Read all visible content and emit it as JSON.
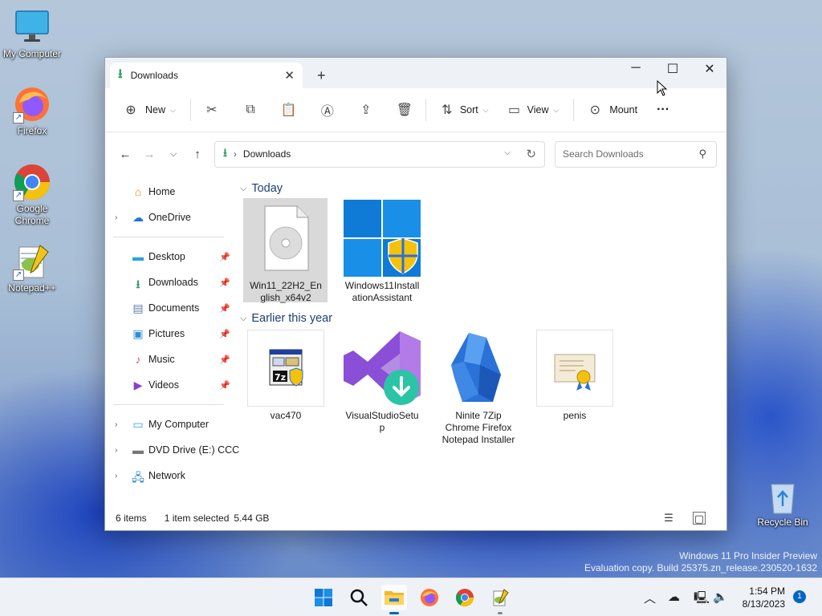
{
  "desktop": {
    "icons": [
      {
        "label": "My Computer"
      },
      {
        "label": "Firefox"
      },
      {
        "label": "Google Chrome"
      },
      {
        "label": "Notepad++"
      },
      {
        "label": "Recycle Bin"
      }
    ],
    "watermark": {
      "line1": "Windows 11 Pro Insider Preview",
      "line2": "Evaluation copy. Build 25375.zn_release.230520-1632"
    }
  },
  "window": {
    "tab": {
      "label": "Downloads",
      "icon": "download-icon"
    },
    "controls": {
      "minimize": "─",
      "maximize": "☐",
      "close": "✕"
    },
    "toolbar": {
      "new_label": "New",
      "sort_label": "Sort",
      "view_label": "View",
      "mount_label": "Mount",
      "more_label": "···"
    },
    "address": {
      "path": "Downloads"
    },
    "search": {
      "placeholder": "Search Downloads"
    },
    "nav": {
      "home": "Home",
      "onedrive": "OneDrive",
      "desktop": "Desktop",
      "downloads": "Downloads",
      "documents": "Documents",
      "pictures": "Pictures",
      "music": "Music",
      "videos": "Videos",
      "my_computer": "My Computer",
      "dvd": "DVD Drive (E:) CCC",
      "network": "Network"
    },
    "groups": {
      "today": "Today",
      "earlier": "Earlier this year"
    },
    "files": {
      "win11": "Win11_22H2_English_x64v2",
      "assistant": "Windows11InstallationAssistant",
      "vac": "vac470",
      "vs": "VisualStudioSetup",
      "ninite": "Ninite 7Zip Chrome Firefox Notepad Installer",
      "penis": "penis"
    },
    "status": {
      "items": "6 items",
      "selected": "1 item selected",
      "size": "5.44 GB"
    }
  },
  "taskbar": {
    "time": "1:54 PM",
    "date": "8/13/2023",
    "notifications": "1"
  },
  "colors": {
    "accent": "#0067c0",
    "downloads_green": "#2f9e65",
    "group_header": "#1d3f73"
  }
}
